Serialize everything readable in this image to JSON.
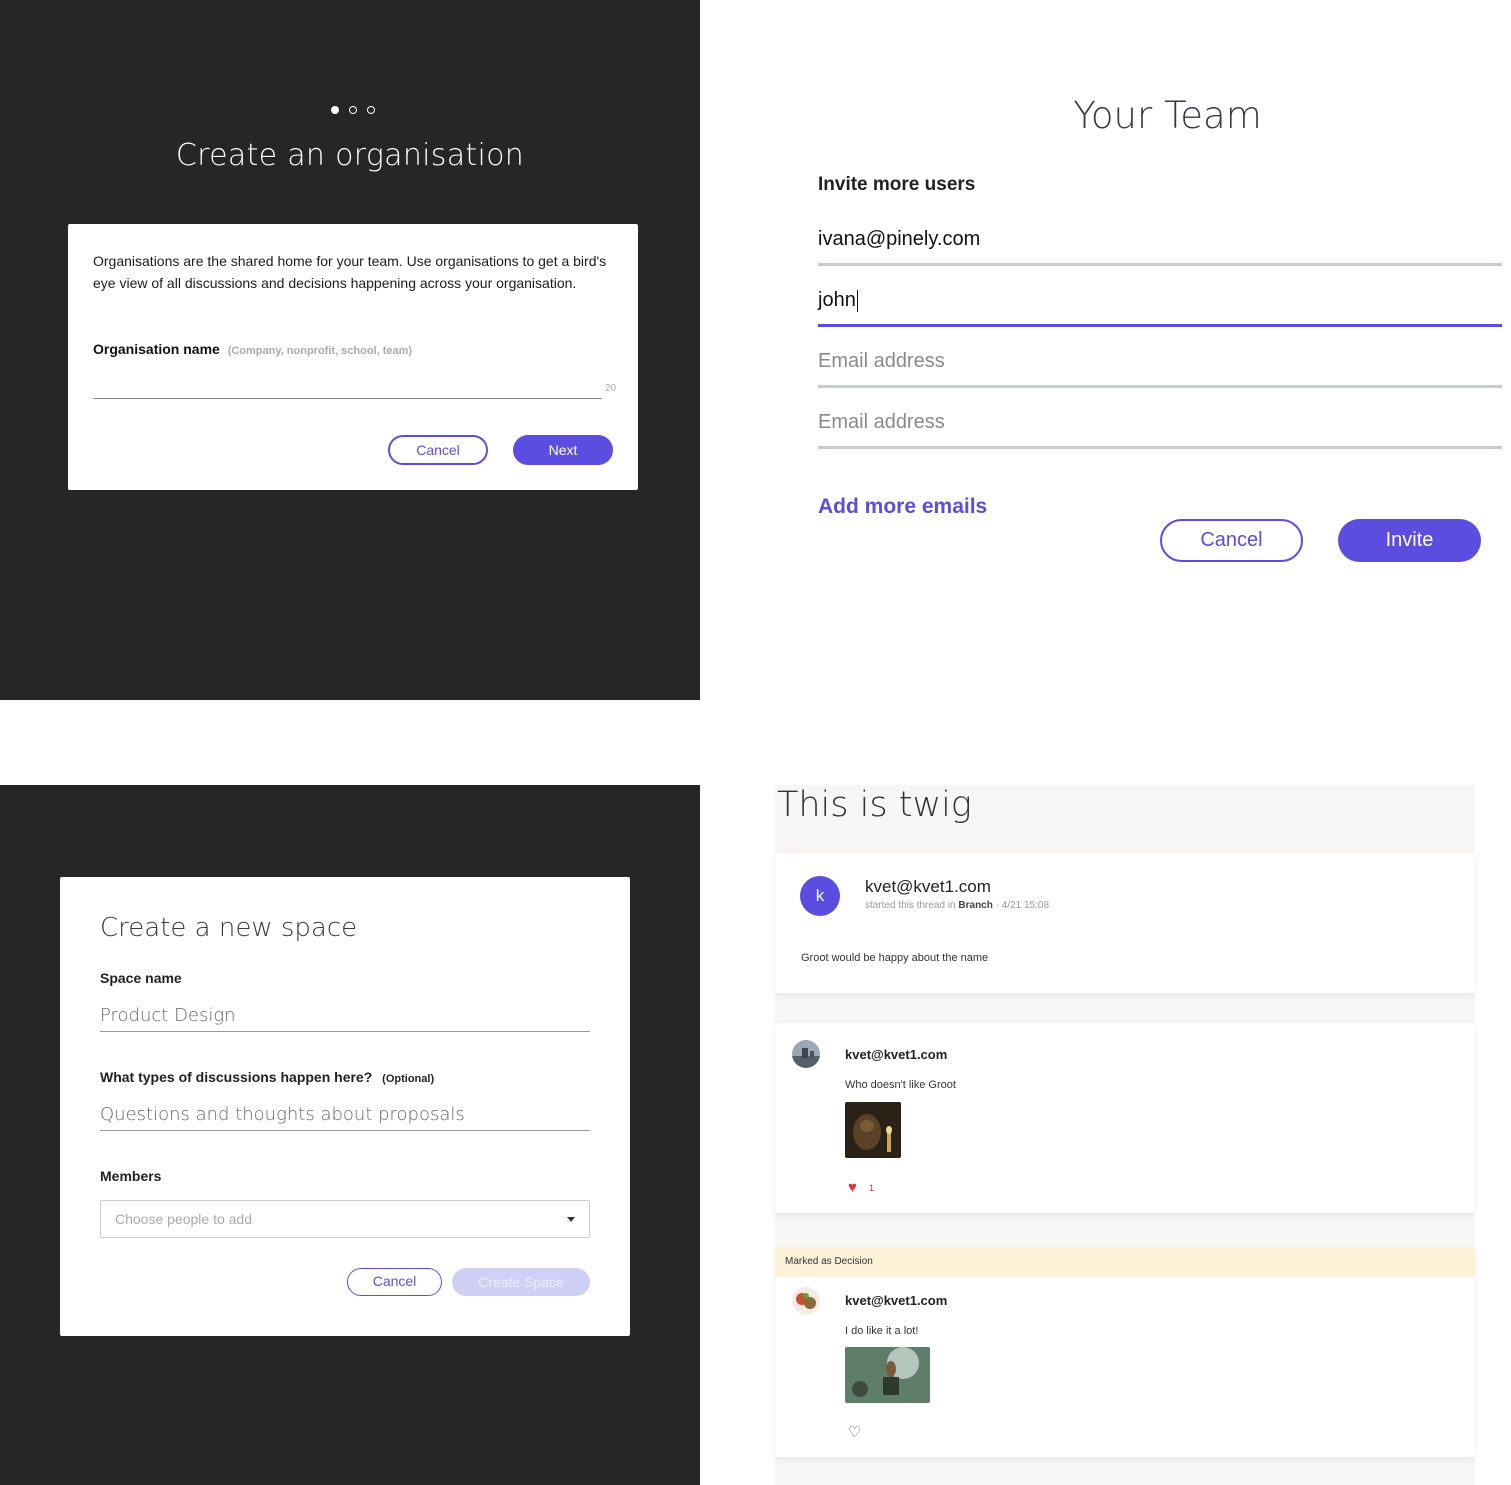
{
  "org": {
    "title": "Create an organisation",
    "description": "Organisations are the shared home for your team. Use organisations to get a bird's eye view of all discussions and decisions happening across your organisation.",
    "name_label": "Organisation name",
    "name_hint": "(Company, nonprofit, school, team)",
    "char_limit": "20",
    "cancel_label": "Cancel",
    "next_label": "Next",
    "steps_total": 3,
    "step_current": 1
  },
  "team": {
    "title": "Your Team",
    "invite_label": "Invite more users",
    "emails": [
      {
        "value": "ivana@pinely.com",
        "placeholder": ""
      },
      {
        "value": "john",
        "placeholder": ""
      },
      {
        "value": "",
        "placeholder": "Email address"
      },
      {
        "value": "",
        "placeholder": "Email address"
      }
    ],
    "add_more_label": "Add more emails",
    "cancel_label": "Cancel",
    "invite_label_btn": "Invite"
  },
  "space": {
    "title": "Create a new space",
    "name_label": "Space name",
    "name_value": "Product Design",
    "discussions_label": "What types of discussions happen here?",
    "discussions_optional": "(Optional)",
    "discussions_value": "Questions and thoughts about proposals",
    "members_label": "Members",
    "members_placeholder": "Choose people to add",
    "cancel_label": "Cancel",
    "create_label": "Create Space"
  },
  "thread": {
    "title": "This is twig",
    "root": {
      "avatar_letter": "k",
      "author": "kvet@kvet1.com",
      "meta_prefix": "started this thread in",
      "meta_space": "Branch",
      "meta_time": "· 4/21 15:08",
      "body": "Groot would be happy about the name"
    },
    "replies": [
      {
        "author": "kvet@kvet1.com",
        "body": "Who doesn't like Groot",
        "likes": "1",
        "liked": true
      },
      {
        "author": "kvet@kvet1.com",
        "body": "I do like it a lot!",
        "likes": "",
        "liked": false,
        "decision_label": "Marked as Decision"
      }
    ]
  },
  "colors": {
    "accent": "#5b4de0",
    "dark_bg": "#262626",
    "decision_bg": "#fdf1d8",
    "heart": "#e0323c"
  },
  "icons": [
    "chevron-down-icon",
    "heart-filled-icon",
    "heart-outline-icon"
  ]
}
